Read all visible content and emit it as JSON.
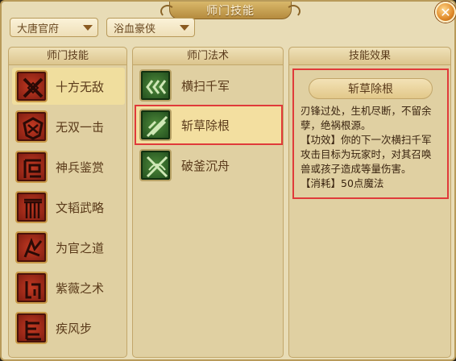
{
  "window": {
    "title": "师门技能",
    "close_symbol": "✕"
  },
  "dropdowns": [
    {
      "value": "大唐官府"
    },
    {
      "value": "浴血豪侠"
    }
  ],
  "panels": {
    "skills_header": "师门技能",
    "arts_header": "师门法术",
    "effect_header": "技能效果"
  },
  "skills": [
    {
      "label": "十方无敌",
      "icon": "crossed-blades-icon",
      "selected": true
    },
    {
      "label": "无双一击",
      "icon": "shield-crest-icon",
      "selected": false
    },
    {
      "label": "神兵鉴赏",
      "icon": "weapon-rack-icon",
      "selected": false
    },
    {
      "label": "文韬武略",
      "icon": "gate-icon",
      "selected": false
    },
    {
      "label": "为官之道",
      "icon": "insignia-icon",
      "selected": false
    },
    {
      "label": "紫薇之术",
      "icon": "rune-icon",
      "selected": false
    },
    {
      "label": "疾风步",
      "icon": "footwork-icon",
      "selected": false
    }
  ],
  "arts": [
    {
      "label": "横扫千军",
      "icon": "sweep-arrows-icon",
      "selected": false
    },
    {
      "label": "斩草除根",
      "icon": "slash-icon",
      "selected": true
    },
    {
      "label": "破釜沉舟",
      "icon": "crossed-sword-bow-icon",
      "selected": false
    }
  ],
  "effect": {
    "title": "斩草除根",
    "lines": [
      "刃锋过处，生机尽断，不留余",
      "孽，绝祸根源。",
      "【功效】你的下一次横扫千军",
      "攻击目标为玩家时，对其召唤",
      "兽或孩子造成等量伤害。",
      "【消耗】50点魔法"
    ]
  },
  "colors": {
    "highlight_border": "#e03a3a",
    "panel_bg": "#e0d0a2",
    "skill_icon_red": "#c33a22",
    "art_icon_green": "#4e8a3a"
  }
}
